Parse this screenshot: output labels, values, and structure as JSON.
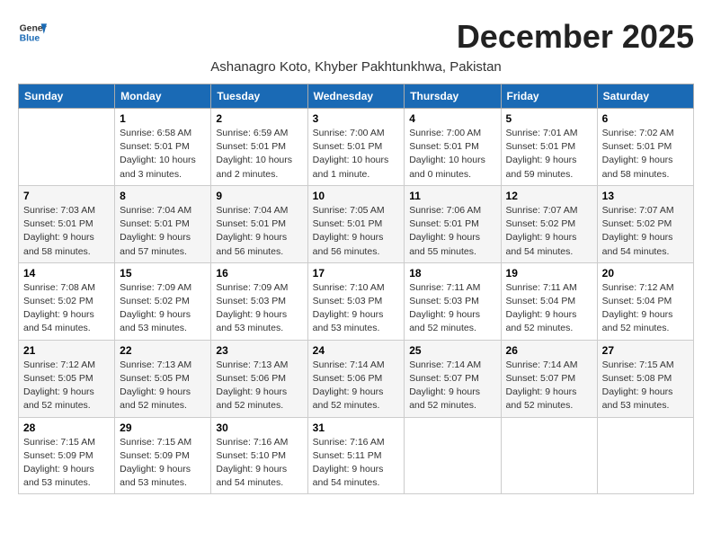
{
  "logo": {
    "line1": "General",
    "line2": "Blue"
  },
  "title": "December 2025",
  "subtitle": "Ashanagro Koto, Khyber Pakhtunkhwa, Pakistan",
  "days_of_week": [
    "Sunday",
    "Monday",
    "Tuesday",
    "Wednesday",
    "Thursday",
    "Friday",
    "Saturday"
  ],
  "weeks": [
    [
      {
        "day": "",
        "info": ""
      },
      {
        "day": "1",
        "info": "Sunrise: 6:58 AM\nSunset: 5:01 PM\nDaylight: 10 hours\nand 3 minutes."
      },
      {
        "day": "2",
        "info": "Sunrise: 6:59 AM\nSunset: 5:01 PM\nDaylight: 10 hours\nand 2 minutes."
      },
      {
        "day": "3",
        "info": "Sunrise: 7:00 AM\nSunset: 5:01 PM\nDaylight: 10 hours\nand 1 minute."
      },
      {
        "day": "4",
        "info": "Sunrise: 7:00 AM\nSunset: 5:01 PM\nDaylight: 10 hours\nand 0 minutes."
      },
      {
        "day": "5",
        "info": "Sunrise: 7:01 AM\nSunset: 5:01 PM\nDaylight: 9 hours\nand 59 minutes."
      },
      {
        "day": "6",
        "info": "Sunrise: 7:02 AM\nSunset: 5:01 PM\nDaylight: 9 hours\nand 58 minutes."
      }
    ],
    [
      {
        "day": "7",
        "info": "Sunrise: 7:03 AM\nSunset: 5:01 PM\nDaylight: 9 hours\nand 58 minutes."
      },
      {
        "day": "8",
        "info": "Sunrise: 7:04 AM\nSunset: 5:01 PM\nDaylight: 9 hours\nand 57 minutes."
      },
      {
        "day": "9",
        "info": "Sunrise: 7:04 AM\nSunset: 5:01 PM\nDaylight: 9 hours\nand 56 minutes."
      },
      {
        "day": "10",
        "info": "Sunrise: 7:05 AM\nSunset: 5:01 PM\nDaylight: 9 hours\nand 56 minutes."
      },
      {
        "day": "11",
        "info": "Sunrise: 7:06 AM\nSunset: 5:01 PM\nDaylight: 9 hours\nand 55 minutes."
      },
      {
        "day": "12",
        "info": "Sunrise: 7:07 AM\nSunset: 5:02 PM\nDaylight: 9 hours\nand 54 minutes."
      },
      {
        "day": "13",
        "info": "Sunrise: 7:07 AM\nSunset: 5:02 PM\nDaylight: 9 hours\nand 54 minutes."
      }
    ],
    [
      {
        "day": "14",
        "info": "Sunrise: 7:08 AM\nSunset: 5:02 PM\nDaylight: 9 hours\nand 54 minutes."
      },
      {
        "day": "15",
        "info": "Sunrise: 7:09 AM\nSunset: 5:02 PM\nDaylight: 9 hours\nand 53 minutes."
      },
      {
        "day": "16",
        "info": "Sunrise: 7:09 AM\nSunset: 5:03 PM\nDaylight: 9 hours\nand 53 minutes."
      },
      {
        "day": "17",
        "info": "Sunrise: 7:10 AM\nSunset: 5:03 PM\nDaylight: 9 hours\nand 53 minutes."
      },
      {
        "day": "18",
        "info": "Sunrise: 7:11 AM\nSunset: 5:03 PM\nDaylight: 9 hours\nand 52 minutes."
      },
      {
        "day": "19",
        "info": "Sunrise: 7:11 AM\nSunset: 5:04 PM\nDaylight: 9 hours\nand 52 minutes."
      },
      {
        "day": "20",
        "info": "Sunrise: 7:12 AM\nSunset: 5:04 PM\nDaylight: 9 hours\nand 52 minutes."
      }
    ],
    [
      {
        "day": "21",
        "info": "Sunrise: 7:12 AM\nSunset: 5:05 PM\nDaylight: 9 hours\nand 52 minutes."
      },
      {
        "day": "22",
        "info": "Sunrise: 7:13 AM\nSunset: 5:05 PM\nDaylight: 9 hours\nand 52 minutes."
      },
      {
        "day": "23",
        "info": "Sunrise: 7:13 AM\nSunset: 5:06 PM\nDaylight: 9 hours\nand 52 minutes."
      },
      {
        "day": "24",
        "info": "Sunrise: 7:14 AM\nSunset: 5:06 PM\nDaylight: 9 hours\nand 52 minutes."
      },
      {
        "day": "25",
        "info": "Sunrise: 7:14 AM\nSunset: 5:07 PM\nDaylight: 9 hours\nand 52 minutes."
      },
      {
        "day": "26",
        "info": "Sunrise: 7:14 AM\nSunset: 5:07 PM\nDaylight: 9 hours\nand 52 minutes."
      },
      {
        "day": "27",
        "info": "Sunrise: 7:15 AM\nSunset: 5:08 PM\nDaylight: 9 hours\nand 53 minutes."
      }
    ],
    [
      {
        "day": "28",
        "info": "Sunrise: 7:15 AM\nSunset: 5:09 PM\nDaylight: 9 hours\nand 53 minutes."
      },
      {
        "day": "29",
        "info": "Sunrise: 7:15 AM\nSunset: 5:09 PM\nDaylight: 9 hours\nand 53 minutes."
      },
      {
        "day": "30",
        "info": "Sunrise: 7:16 AM\nSunset: 5:10 PM\nDaylight: 9 hours\nand 54 minutes."
      },
      {
        "day": "31",
        "info": "Sunrise: 7:16 AM\nSunset: 5:11 PM\nDaylight: 9 hours\nand 54 minutes."
      },
      {
        "day": "",
        "info": ""
      },
      {
        "day": "",
        "info": ""
      },
      {
        "day": "",
        "info": ""
      }
    ]
  ]
}
